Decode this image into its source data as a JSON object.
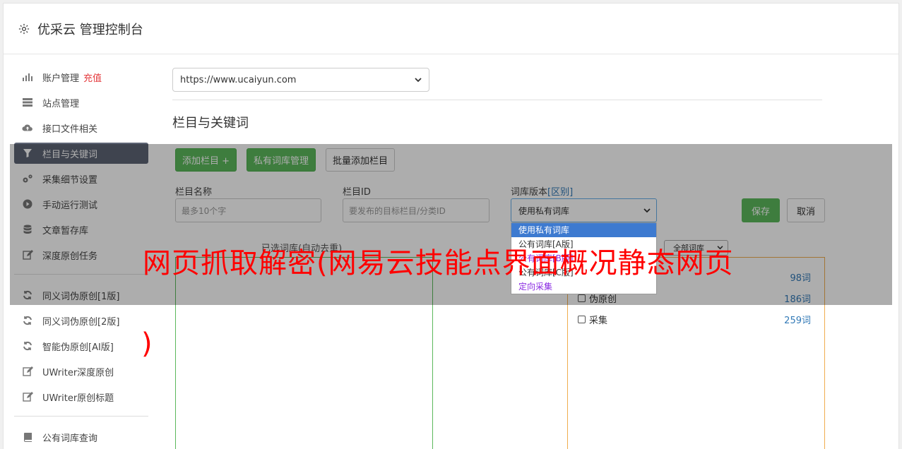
{
  "header": {
    "title": "优采云 管理控制台"
  },
  "sidebar": {
    "items": [
      {
        "label": "账户管理",
        "extra": "充值",
        "icon": "bar-chart-icon"
      },
      {
        "label": "站点管理",
        "icon": "server-icon"
      },
      {
        "label": "接口文件相关",
        "icon": "cloud-upload-icon"
      },
      {
        "label": "栏目与关键词",
        "icon": "filter-icon",
        "active": true
      },
      {
        "label": "采集细节设置",
        "icon": "gears-icon"
      },
      {
        "label": "手动运行测试",
        "icon": "play-icon"
      },
      {
        "label": "文章暂存库",
        "icon": "database-icon"
      },
      {
        "label": "深度原创任务",
        "icon": "edit-icon"
      },
      {
        "label": "同义词伪原创[1版]",
        "icon": "refresh-icon"
      },
      {
        "label": "同义词伪原创[2版]",
        "icon": "refresh-icon"
      },
      {
        "label": "智能伪原创[AI版]",
        "icon": "refresh-icon"
      },
      {
        "label": "UWriter深度原创",
        "icon": "edit-icon"
      },
      {
        "label": "UWriter原创标题",
        "icon": "edit-icon"
      },
      {
        "label": "公有词库查询",
        "icon": "book-icon"
      }
    ]
  },
  "main": {
    "site_select": "https://www.ucaiyun.com",
    "section_title": "栏目与关键词",
    "buttons": {
      "add_column": "添加栏目 +",
      "private_lib": "私有词库管理",
      "batch_add": "批量添加栏目"
    },
    "form": {
      "column_name_label": "栏目名称",
      "column_name_placeholder": "最多10个字",
      "column_id_label": "栏目ID",
      "column_id_placeholder": "要发布的目标栏目/分类ID",
      "lib_version_label": "词库版本",
      "lib_version_link": "[区别]",
      "lib_version_value": "使用私有词库",
      "save": "保存",
      "cancel": "取消"
    },
    "dropdown_options": [
      "使用私有词库",
      "公有词库[A版]",
      "公有词库[B版]",
      "公有词库[C版]",
      "定向采集"
    ],
    "selected_lib_label": "已选词库(自动去重)",
    "all_lib_select": "全部词库",
    "libraries": [
      {
        "name": "",
        "count": "98词"
      },
      {
        "name": "伪原创",
        "count": "186词"
      },
      {
        "name": "采集",
        "count": "259词"
      }
    ]
  },
  "watermark": {
    "text": "网页抓取解密(网易云技能点界面概况静态网页",
    "paren": ")"
  },
  "colors": {
    "green": "#5cb85c",
    "active_sidebar": "#5e6575",
    "link": "#337ab7",
    "watermark": "#ff0000"
  }
}
